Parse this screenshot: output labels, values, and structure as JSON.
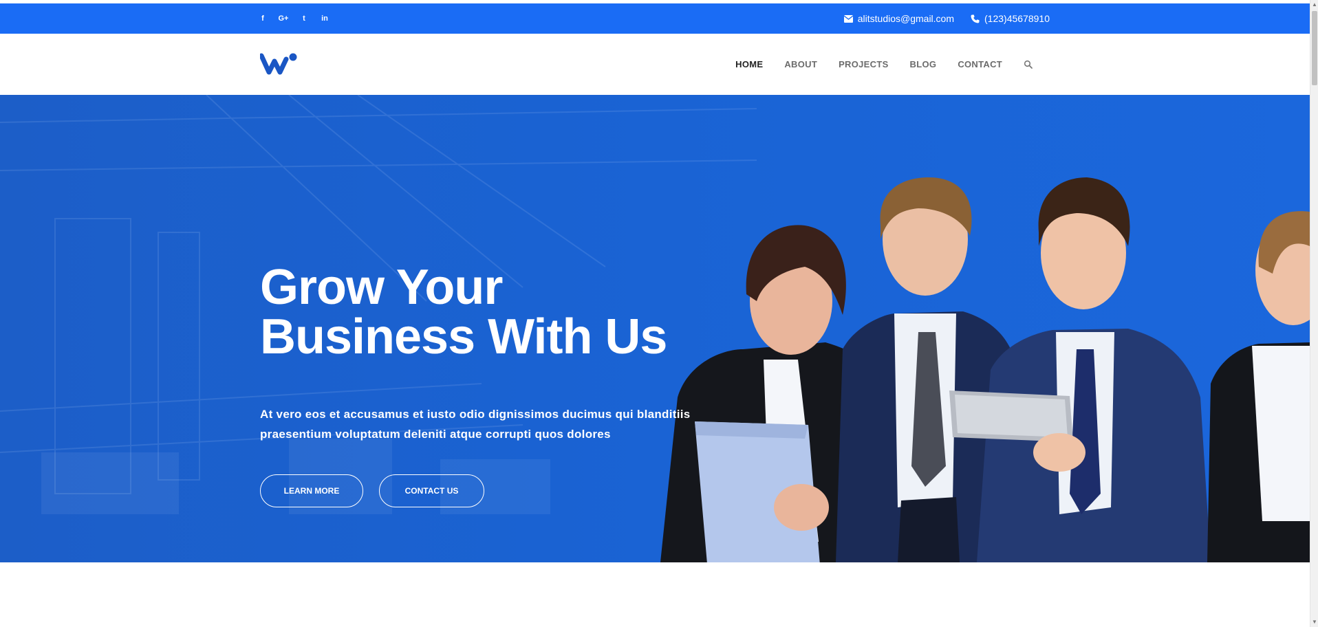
{
  "topbar": {
    "social": [
      {
        "name": "facebook-icon",
        "glyph": "f"
      },
      {
        "name": "google-plus-icon",
        "glyph": "G+"
      },
      {
        "name": "twitter-icon",
        "glyph": "t"
      },
      {
        "name": "linkedin-icon",
        "glyph": "in"
      }
    ],
    "email": "alitstudios@gmail.com",
    "phone": "(123)45678910",
    "bg_color": "#1a6cf5"
  },
  "nav": {
    "items": [
      {
        "label": "HOME",
        "active": true
      },
      {
        "label": "ABOUT",
        "active": false
      },
      {
        "label": "PROJECTS",
        "active": false
      },
      {
        "label": "BLOG",
        "active": false
      },
      {
        "label": "CONTACT",
        "active": false
      }
    ],
    "search_icon": "search-icon",
    "logo_color": "#1a56c4"
  },
  "hero": {
    "title_line1": "Grow Your",
    "title_line2": "Business With Us",
    "subtitle": "At vero eos et accusamus et iusto odio dignissimos ducimus qui blanditiis praesentium voluptatum deleniti atque corrupti quos dolores",
    "btn_learn": "LEARN MORE",
    "btn_contact": "CONTACT US",
    "bg_color": "#1a5fcf"
  }
}
